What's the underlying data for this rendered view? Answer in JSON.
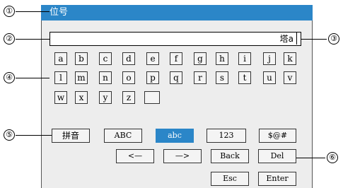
{
  "window": {
    "title": "位号"
  },
  "input": {
    "value": "塔a"
  },
  "letter_rows": [
    [
      "a",
      "b",
      "c",
      "d",
      "e",
      "f",
      "g",
      "h",
      "i",
      "j",
      "k"
    ],
    [
      "l",
      "m",
      "n",
      "o",
      "p",
      "q",
      "r",
      "s",
      "t",
      "u",
      "v"
    ],
    [
      "w",
      "x",
      "y",
      "z",
      ""
    ]
  ],
  "modes": {
    "pinyin": "拼音",
    "upper": "ABC",
    "lower": "abc",
    "digits": "123",
    "symbols": "$@#",
    "selected": "abc"
  },
  "controls": {
    "left": "<—",
    "right": "—>",
    "back": "Back",
    "del": "Del",
    "esc": "Esc",
    "enter": "Enter"
  },
  "callouts": [
    "①",
    "②",
    "③",
    "④",
    "⑤",
    "⑥"
  ],
  "colors": {
    "accent": "#2b86c8",
    "panel": "#ededed",
    "key_face": "#f4f4f4"
  }
}
